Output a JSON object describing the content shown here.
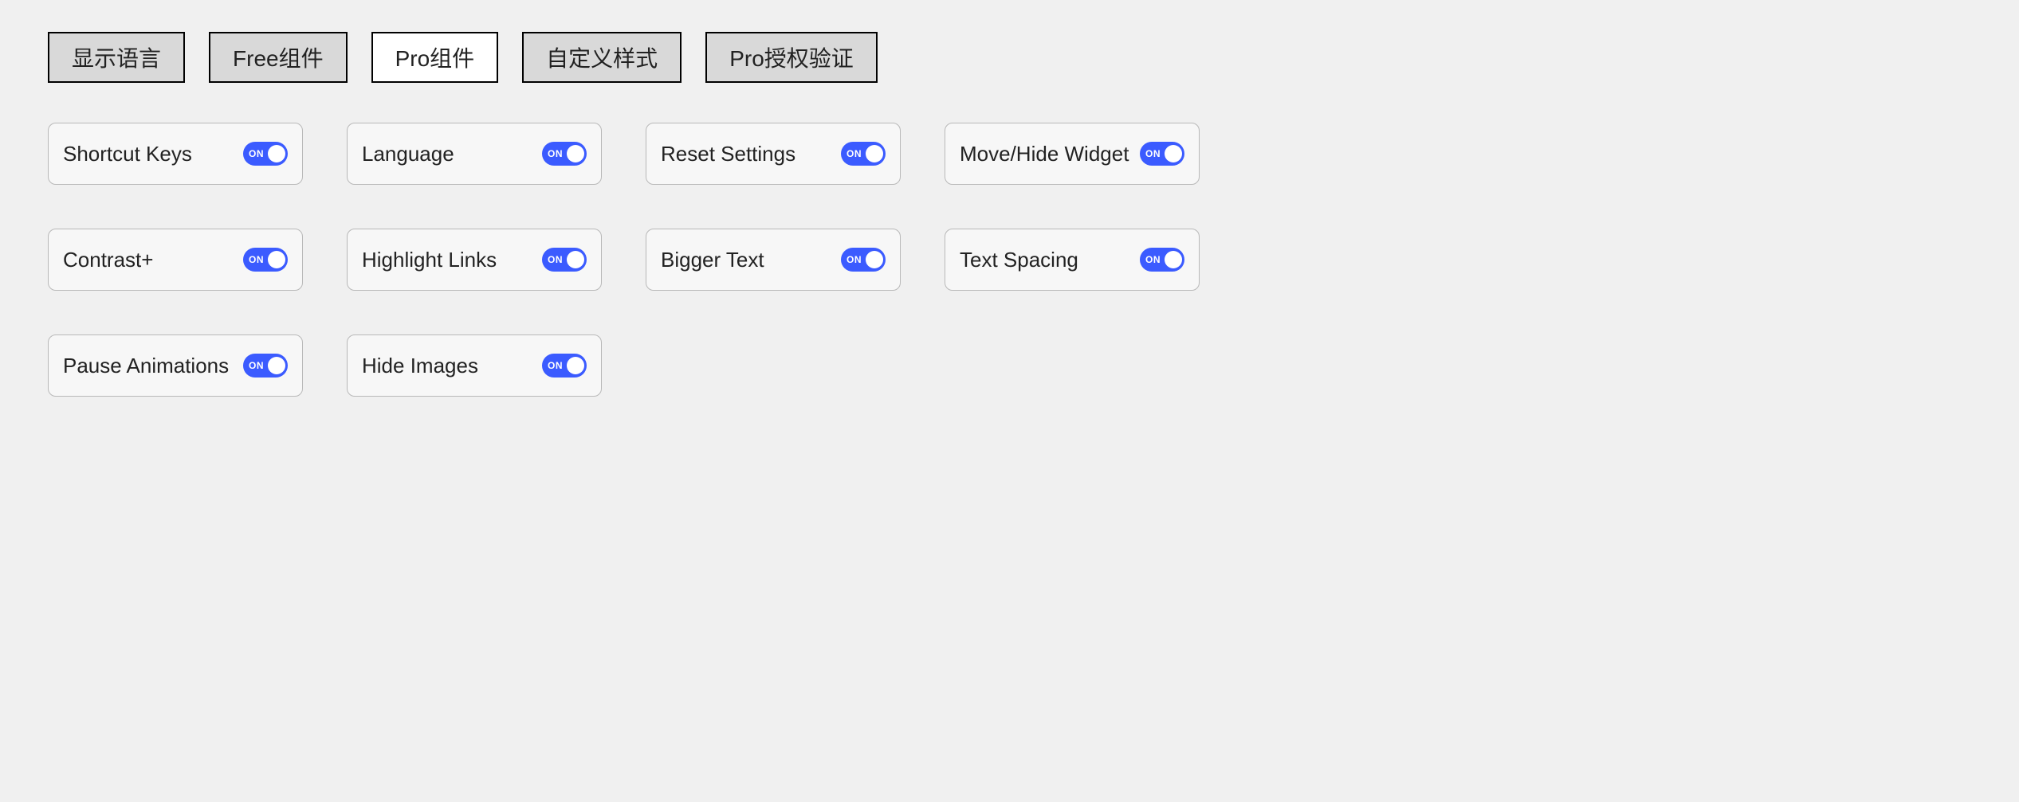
{
  "tabs": [
    {
      "label": "显示语言",
      "style": "filled"
    },
    {
      "label": "Free组件",
      "style": "filled"
    },
    {
      "label": "Pro组件",
      "style": "outline"
    },
    {
      "label": "自定义样式",
      "style": "filled"
    },
    {
      "label": "Pro授权验证",
      "style": "filled"
    }
  ],
  "toggle_on_text": "ON",
  "cards": {
    "row1": [
      {
        "label": "Shortcut Keys",
        "on": true
      },
      {
        "label": "Language",
        "on": true
      },
      {
        "label": "Reset  Settings",
        "on": true
      },
      {
        "label": "Move/Hide Widget",
        "on": true
      }
    ],
    "row2": [
      {
        "label": "Contrast+",
        "on": true
      },
      {
        "label": "Highlight Links",
        "on": true
      },
      {
        "label": "Bigger Text",
        "on": true
      },
      {
        "label": "Text Spacing",
        "on": true
      }
    ],
    "row3": [
      {
        "label": "Pause Animations",
        "on": true
      },
      {
        "label": "Hide Images",
        "on": true
      }
    ]
  }
}
